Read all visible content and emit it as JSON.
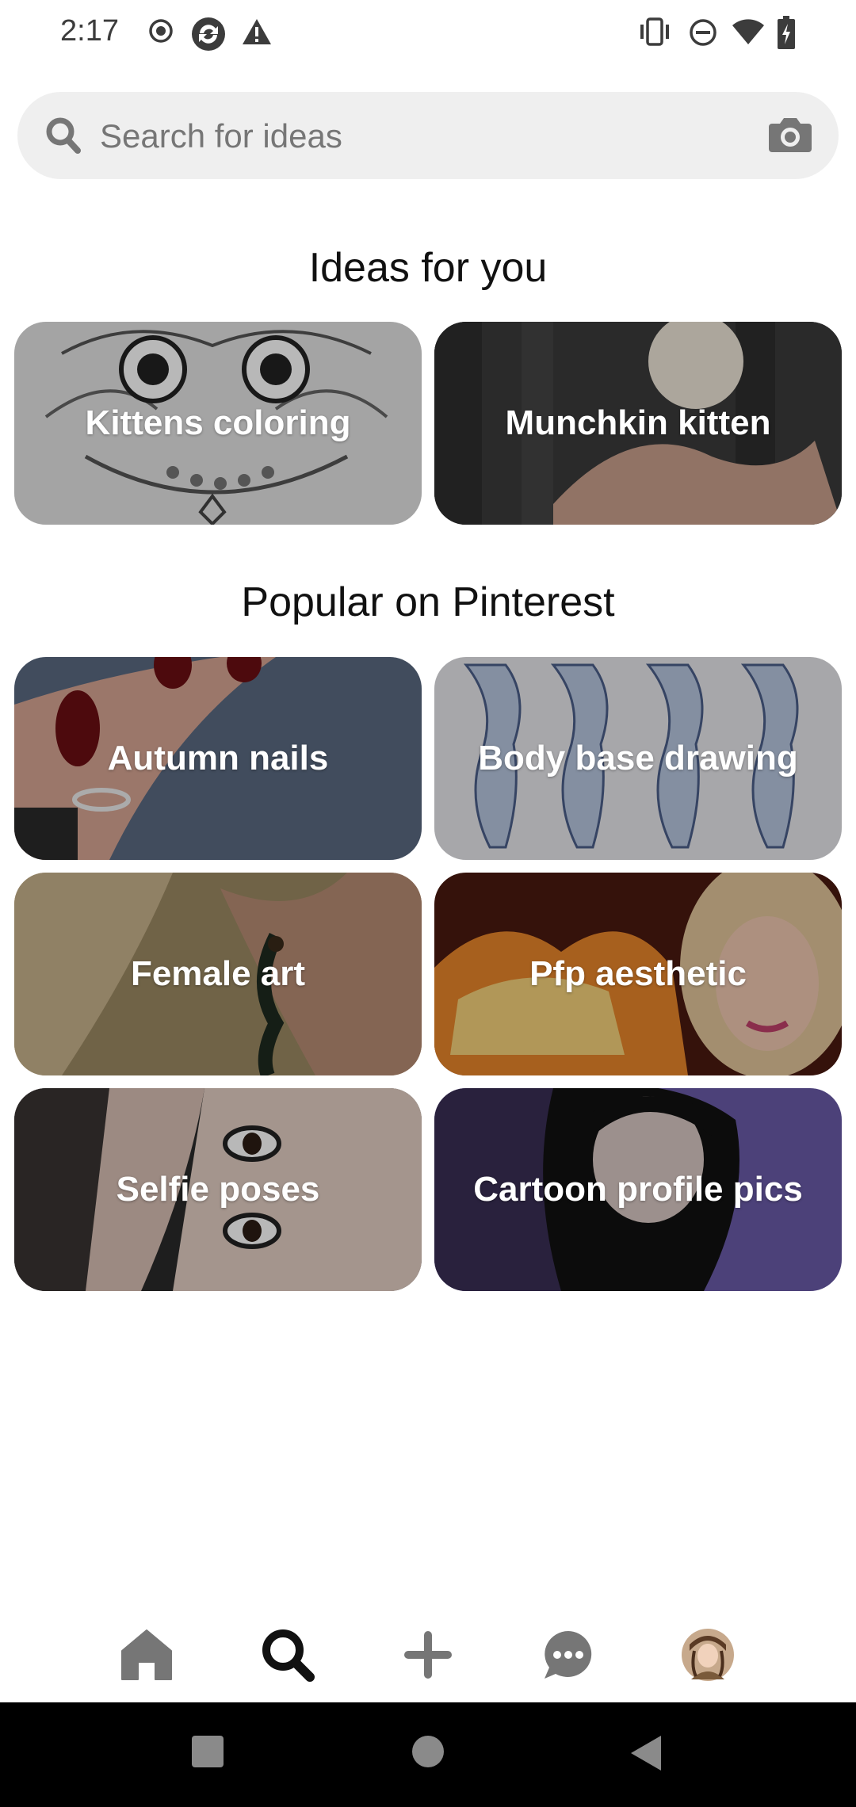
{
  "status_bar": {
    "time": "2:17",
    "left_icons": [
      "record-icon",
      "sync-app-icon",
      "warning-icon"
    ],
    "right_icons": [
      "vibrate-icon",
      "do-not-disturb-icon",
      "wifi-icon",
      "battery-charging-icon"
    ]
  },
  "search": {
    "placeholder": "Search for ideas",
    "icon": "search-icon",
    "camera_icon": "camera-icon"
  },
  "ideas_section": {
    "title": "Ideas for you",
    "tiles": [
      {
        "label": "Kittens coloring"
      },
      {
        "label": "Munchkin kitten"
      }
    ]
  },
  "popular_section": {
    "title": "Popular on Pinterest",
    "tiles": [
      {
        "label": "Autumn nails"
      },
      {
        "label": "Body base drawing"
      },
      {
        "label": "Female art"
      },
      {
        "label": "Pfp aesthetic"
      },
      {
        "label": "Selfie poses"
      },
      {
        "label": "Cartoon profile pics"
      }
    ]
  },
  "bottom_nav": {
    "items": [
      "home-icon",
      "search-icon",
      "plus-icon",
      "messages-icon",
      "profile-avatar"
    ],
    "active": "search-icon"
  },
  "system_nav": [
    "recents-icon",
    "home-circle-icon",
    "back-icon"
  ],
  "colors": {
    "search_bg": "#efefef",
    "text_primary": "#111111",
    "placeholder": "#767676",
    "nav_icon": "#767676",
    "nav_active": "#111111"
  }
}
